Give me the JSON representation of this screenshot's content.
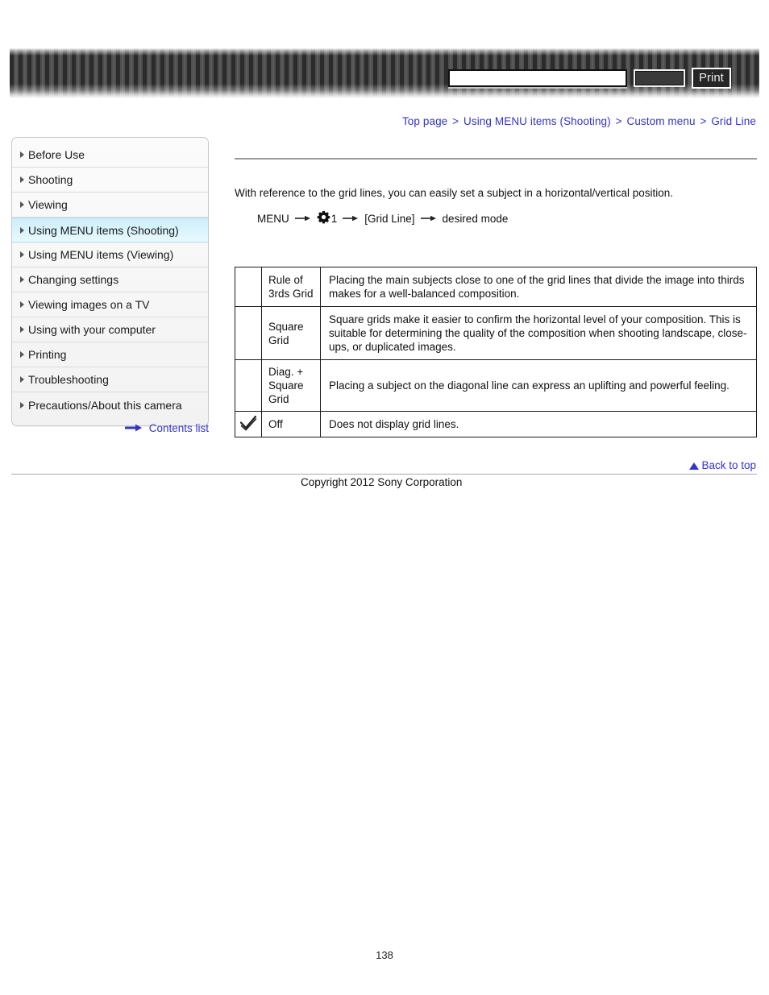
{
  "header": {
    "search_value": "",
    "search_placeholder": "",
    "search_button_label": "",
    "print_button_label": "Print"
  },
  "breadcrumb": {
    "separator": ">",
    "items": [
      {
        "label": "Top page"
      },
      {
        "label": "Using MENU items (Shooting)"
      },
      {
        "label": "Custom menu"
      },
      {
        "label": "Grid Line"
      }
    ]
  },
  "sidebar": {
    "items": [
      {
        "label": "Before Use",
        "active": false
      },
      {
        "label": "Shooting",
        "active": false
      },
      {
        "label": "Viewing",
        "active": false
      },
      {
        "label": "Using MENU items (Shooting)",
        "active": true
      },
      {
        "label": "Using MENU items (Viewing)",
        "active": false
      },
      {
        "label": "Changing settings",
        "active": false
      },
      {
        "label": "Viewing images on a TV",
        "active": false
      },
      {
        "label": "Using with your computer",
        "active": false
      },
      {
        "label": "Printing",
        "active": false
      },
      {
        "label": "Troubleshooting",
        "active": false
      },
      {
        "label": "Precautions/About this camera",
        "active": false
      }
    ],
    "contents_list_label": "Contents list"
  },
  "content": {
    "intro": "With reference to the grid lines, you can easily set a subject in a horizontal/vertical position.",
    "menu_path": {
      "start": "MENU",
      "gear_number": "1",
      "item": "[Grid Line]",
      "end": "desired mode"
    }
  },
  "table": {
    "rows": [
      {
        "checked": false,
        "label": "Rule of 3rds Grid",
        "description": "Placing the main subjects close to one of the grid lines that divide the image into thirds makes for a well-balanced composition."
      },
      {
        "checked": false,
        "label": "Square Grid",
        "description": "Square grids make it easier to confirm the horizontal level of your composition. This is suitable for determining the quality of the composition when shooting landscape, close-ups, or duplicated images."
      },
      {
        "checked": false,
        "label": "Diag. + Square Grid",
        "description": "Placing a subject on the diagonal line can express an uplifting and powerful feeling."
      },
      {
        "checked": true,
        "label": "Off",
        "description": "Does not display grid lines."
      }
    ]
  },
  "footer": {
    "back_to_top_label": "Back to top",
    "copyright": "Copyright 2012 Sony Corporation",
    "page_number": "138"
  },
  "colors": {
    "link": "#3333CC",
    "sidebar_active": "#D8F3FB",
    "header_stripe_dark": "#2B2B2B"
  }
}
